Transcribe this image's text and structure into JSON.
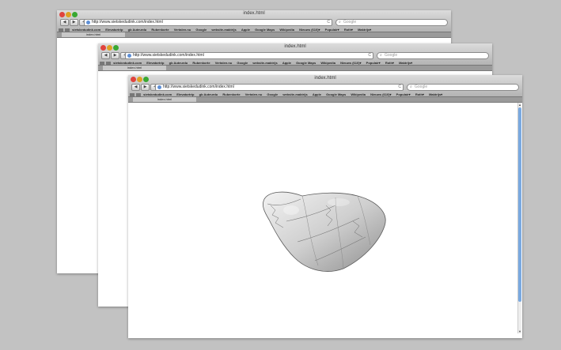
{
  "window": {
    "title": "index.html",
    "url": "http://www.sietskedudink.com/index.html",
    "search_placeholder": "Google",
    "tab_label": "index.html",
    "nav": {
      "back": "◀",
      "forward": "▶",
      "add": "+",
      "reload": "C"
    }
  },
  "bookmarks_small": [
    "sietskedudink.com",
    "Elevatortrip",
    "gb Auteurdu",
    "Rubenkorte",
    "Vertalen.nu",
    "Google",
    "website-maktrijs",
    "Apple",
    "Google Maps",
    "Wikipedia",
    "Nieuws (610)▾",
    "Populair▾",
    "Roth▾",
    "Maktrijs▾"
  ],
  "bookmarks_large": [
    "sietskedudink.com",
    "Elevatortrip",
    "gb Auteurdu",
    "Rubenkorte",
    "Vertalen.nu",
    "Google",
    "website-maktrijs",
    "Apple",
    "Google Maps",
    "Wikipedia",
    "Nieuws (610)▾",
    "Populair▾",
    "Roth▾",
    "Maktrijs▾"
  ],
  "colors": {
    "background": "#c2c2c2",
    "scrollbar_thumb": "#7aa9e0",
    "close": "#e0443e",
    "minimize": "#dea123",
    "zoom": "#39a832"
  },
  "content": {
    "object": "3d-rock-render"
  }
}
